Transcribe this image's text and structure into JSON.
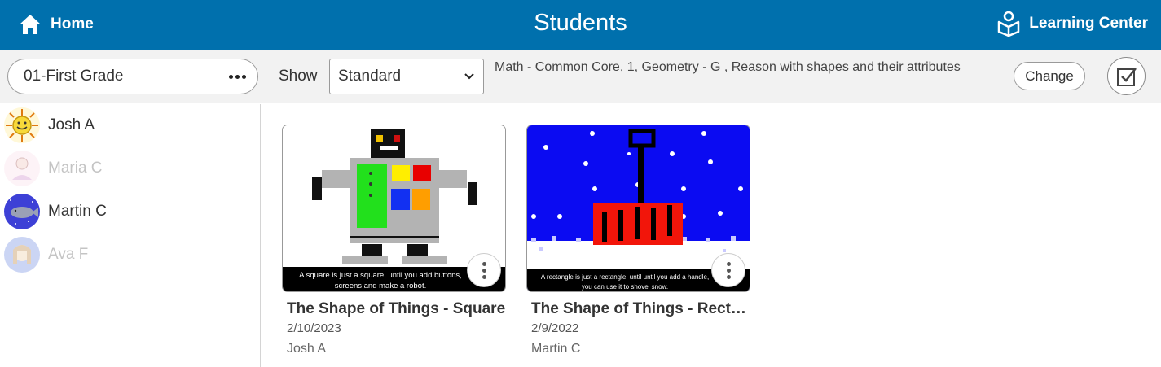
{
  "header": {
    "home_label": "Home",
    "title": "Students",
    "learning_label": "Learning Center",
    "background": "#0070ad"
  },
  "toolbar": {
    "class_label": "01-First Grade",
    "show_label": "Show",
    "show_value": "Standard",
    "standard_text": "Math - Common Core, 1, Geometry - G , Reason with shapes and their attributes",
    "change_label": "Change"
  },
  "students": [
    {
      "name": "Josh A",
      "dimmed": false
    },
    {
      "name": "Maria C",
      "dimmed": true
    },
    {
      "name": "Martin C",
      "dimmed": false
    },
    {
      "name": "Ava F",
      "dimmed": true
    }
  ],
  "cards": [
    {
      "title": "The Shape of Things - Square",
      "date": "2/10/2023",
      "author": "Josh A",
      "caption_line1": "A square is just a square, until you add buttons,",
      "caption_line2": "screens and make a robot."
    },
    {
      "title": "The Shape of Things - Rectangle",
      "date": "2/9/2022",
      "author": "Martin C",
      "caption_line1": "A rectangle is just a rectangle, until until you add a handle,",
      "caption_line2": "you can use it to shovel snow."
    }
  ]
}
